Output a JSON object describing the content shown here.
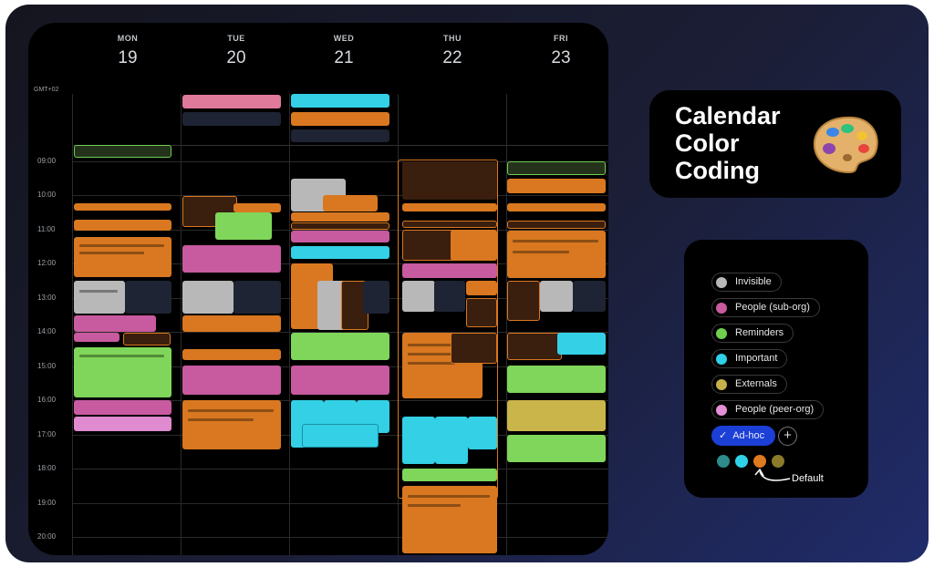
{
  "days": [
    {
      "name": "MON",
      "date": "19"
    },
    {
      "name": "TUE",
      "date": "20"
    },
    {
      "name": "WED",
      "date": "21"
    },
    {
      "name": "THU",
      "date": "22"
    },
    {
      "name": "FRI",
      "date": "23"
    }
  ],
  "timezone": "GMT+02",
  "hours": [
    "09:00",
    "10:00",
    "11:00",
    "12:00",
    "13:00",
    "14:00",
    "15:00",
    "16:00",
    "17:00",
    "18:00",
    "19:00",
    "20:00"
  ],
  "headline": {
    "line1": "Calendar",
    "line2": "Color",
    "line3": "Coding"
  },
  "legend": {
    "items": [
      {
        "label": "Invisible",
        "color": "#b8b8b8"
      },
      {
        "label": "People (sub-org)",
        "color": "#c85a9f"
      },
      {
        "label": "Reminders",
        "color": "#6fd04f"
      },
      {
        "label": "Important",
        "color": "#2ed1e8"
      },
      {
        "label": "Externals",
        "color": "#c7b04a"
      },
      {
        "label": "People (peer-org)",
        "color": "#e48fd6"
      }
    ],
    "selected": "Ad-hoc",
    "swatches": [
      "#2e8b8b",
      "#2ed1e8",
      "#e07a1e",
      "#8a7a2a"
    ],
    "default_label": "Default"
  },
  "colors": {
    "orange": "#d97820",
    "grey": "#b8b8b8",
    "pink": "#c85a9f",
    "green": "#7fd65a",
    "cyan": "#33d0e6",
    "olive": "#c9b54a",
    "lpink": "#e08ad0",
    "dark": "#1e2433",
    "brown": "#3a1e0e"
  }
}
